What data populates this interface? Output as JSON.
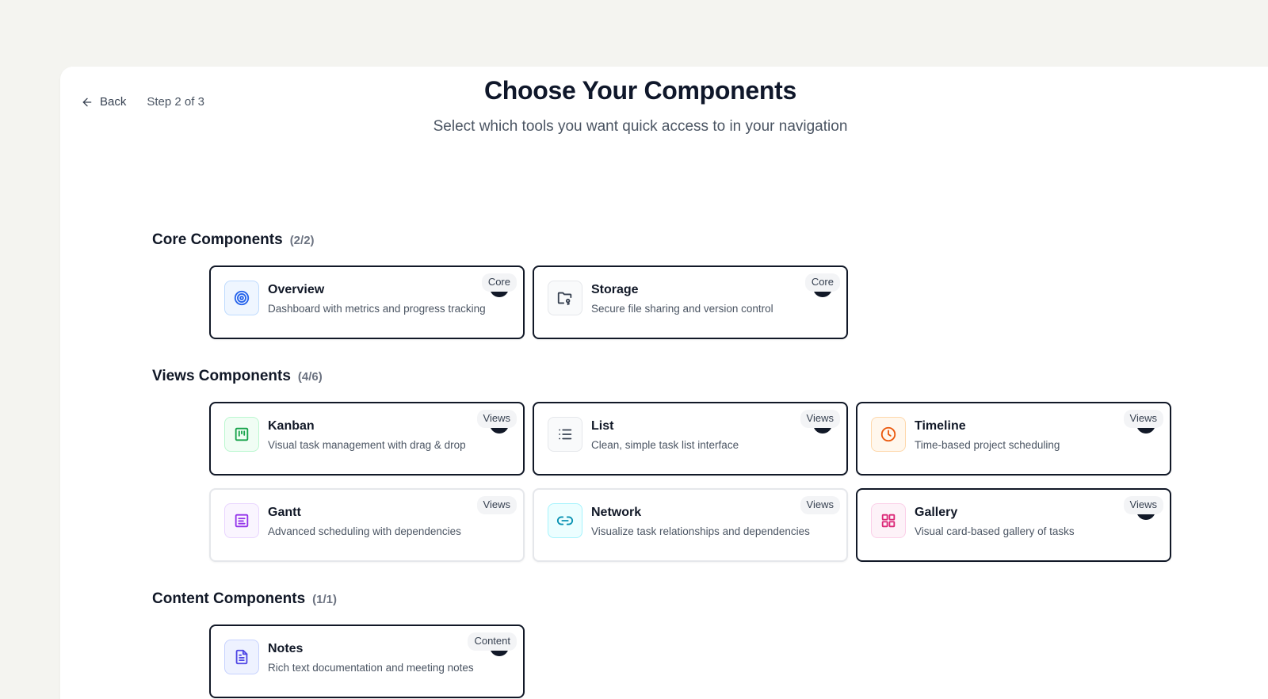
{
  "nav": {
    "back_label": "Back",
    "step_label": "Step 2 of 3"
  },
  "header": {
    "title": "Choose Your Components",
    "subtitle": "Select which tools you want quick access to in your navigation"
  },
  "sections": {
    "core": {
      "title": "Core Components",
      "count": "(2/2)",
      "cards": [
        {
          "name": "Overview",
          "desc": "Dashboard with metrics and progress tracking",
          "badge": "Core",
          "icon": "target-icon",
          "color": "#2563eb",
          "selected": true
        },
        {
          "name": "Storage",
          "desc": "Secure file sharing and version control",
          "badge": "Core",
          "icon": "folder-key-icon",
          "color": "#374151",
          "selected": true
        }
      ]
    },
    "views": {
      "title": "Views Components",
      "count": "(4/6)",
      "cards": [
        {
          "name": "Kanban",
          "desc": "Visual task management with drag & drop",
          "badge": "Views",
          "icon": "kanban-icon",
          "color": "#16a34a",
          "selected": true
        },
        {
          "name": "List",
          "desc": "Clean, simple task list interface",
          "badge": "Views",
          "icon": "list-icon",
          "color": "#374151",
          "selected": true
        },
        {
          "name": "Timeline",
          "desc": "Time-based project scheduling",
          "badge": "Views",
          "icon": "clock-icon",
          "color": "#ea580c",
          "selected": true
        },
        {
          "name": "Gantt",
          "desc": "Advanced scheduling with dependencies",
          "badge": "Views",
          "icon": "gantt-icon",
          "color": "#9333ea",
          "selected": false
        },
        {
          "name": "Network",
          "desc": "Visualize task relationships and dependencies",
          "badge": "Views",
          "icon": "link-icon",
          "color": "#0891b2",
          "selected": false
        },
        {
          "name": "Gallery",
          "desc": "Visual card-based gallery of tasks",
          "badge": "Views",
          "icon": "grid-icon",
          "color": "#db2777",
          "selected": true
        }
      ]
    },
    "content": {
      "title": "Content Components",
      "count": "(1/1)",
      "cards": [
        {
          "name": "Notes",
          "desc": "Rich text documentation and meeting notes",
          "badge": "Content",
          "icon": "document-icon",
          "color": "#4f46e5",
          "selected": true
        }
      ]
    }
  }
}
